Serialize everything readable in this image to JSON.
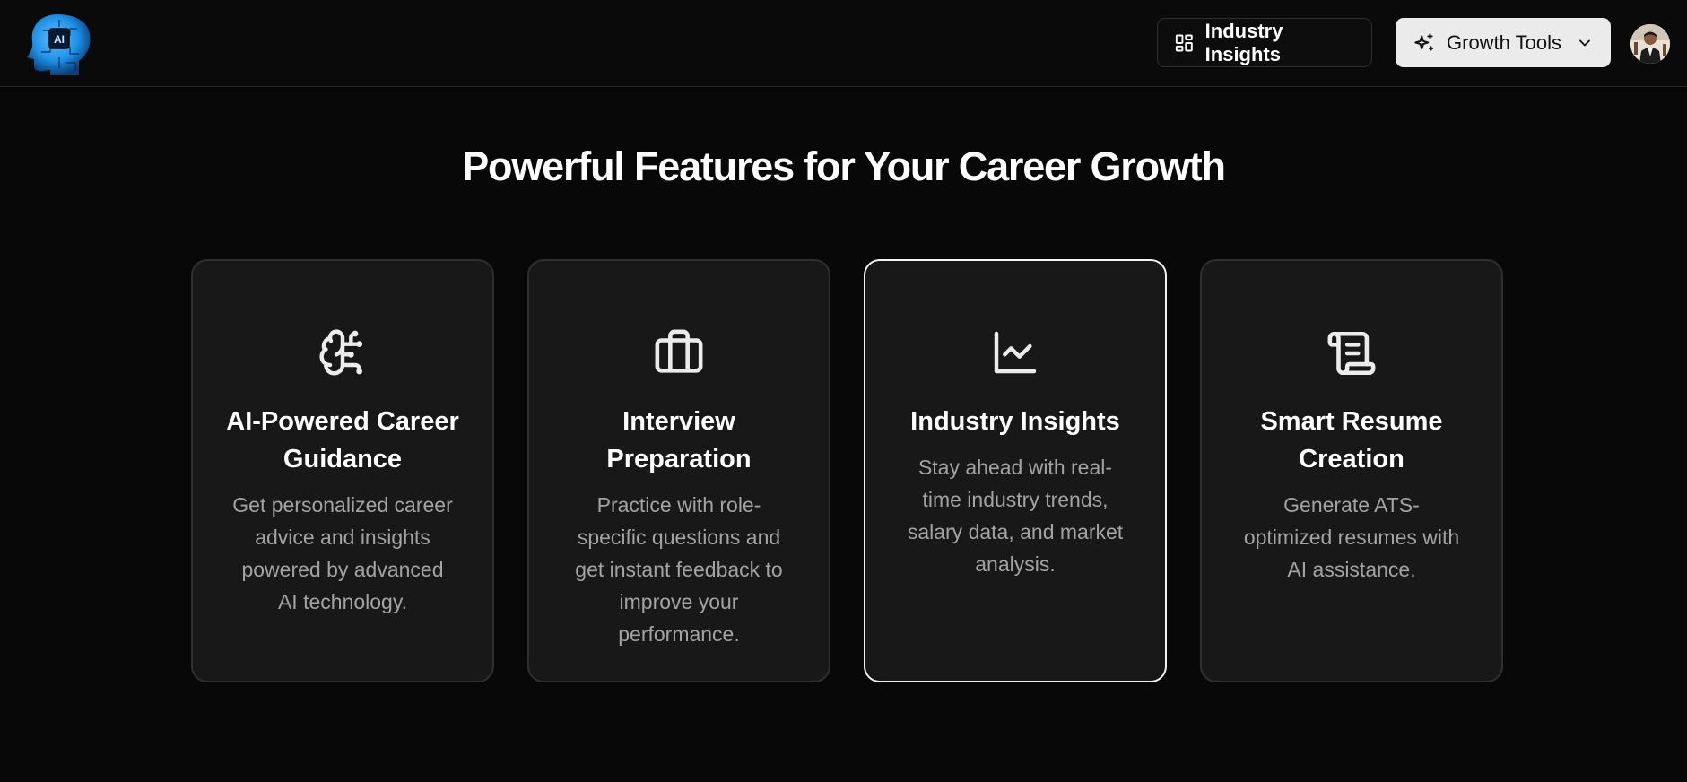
{
  "header": {
    "logo_text": "AI",
    "industry_insights_label": "Industry Insights",
    "growth_tools_label": "Growth Tools"
  },
  "main": {
    "heading": "Powerful Features for Your Career Growth",
    "features": [
      {
        "icon": "brain-circuit-icon",
        "title": "AI-Powered Career Guidance",
        "description": "Get personalized career advice and insights powered by advanced AI technology."
      },
      {
        "icon": "briefcase-icon",
        "title": "Interview Preparation",
        "description": "Practice with role-specific questions and get instant feedback to improve your performance."
      },
      {
        "icon": "line-chart-icon",
        "title": "Industry Insights",
        "description": "Stay ahead with real-time industry trends, salary data, and market analysis."
      },
      {
        "icon": "scroll-text-icon",
        "title": "Smart Resume Creation",
        "description": "Generate ATS-optimized resumes with AI assistance."
      }
    ]
  },
  "colors": {
    "background": "#080808",
    "card_background": "#181818",
    "card_border": "#2f2f2f",
    "active_card_border": "#f2f2f2",
    "logo_blue": "#1e90e6",
    "muted_text": "#a3a3a3"
  }
}
